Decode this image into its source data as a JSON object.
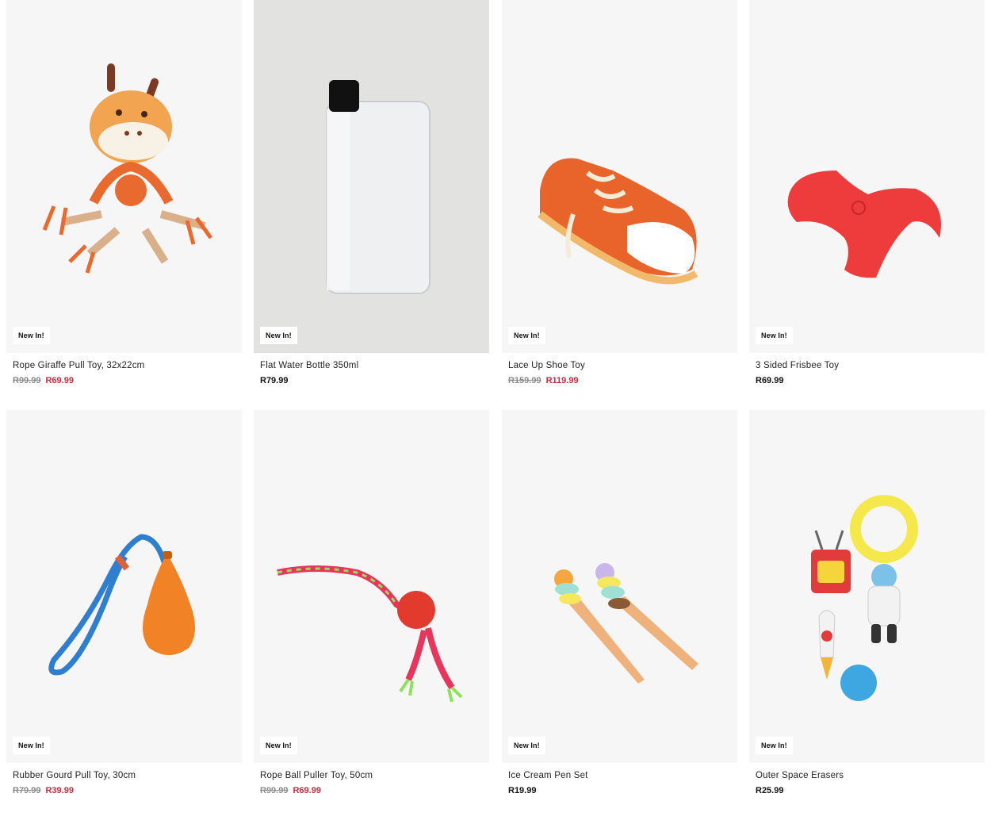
{
  "badge_label": "New In!",
  "products": [
    {
      "title": "Rope Giraffe Pull Toy, 32x22cm",
      "was_price": "R99.99",
      "price": "R69.99",
      "image": "giraffe-rope-toy"
    },
    {
      "title": "Flat Water Bottle 350ml",
      "was_price": "",
      "price": "R79.99",
      "image": "flat-water-bottle"
    },
    {
      "title": "Lace Up Shoe Toy",
      "was_price": "R159.99",
      "price": "R119.99",
      "image": "shoe-toy"
    },
    {
      "title": "3 Sided Frisbee Toy",
      "was_price": "",
      "price": "R69.99",
      "image": "frisbee-toy"
    },
    {
      "title": "Rubber Gourd Pull Toy, 30cm",
      "was_price": "R79.99",
      "price": "R39.99",
      "image": "gourd-pull-toy"
    },
    {
      "title": "Rope Ball Puller Toy, 50cm",
      "was_price": "R99.99",
      "price": "R69.99",
      "image": "rope-ball-toy"
    },
    {
      "title": "Ice Cream Pen Set",
      "was_price": "",
      "price": "R19.99",
      "image": "ice-cream-pens"
    },
    {
      "title": "Outer Space Erasers",
      "was_price": "",
      "price": "R25.99",
      "image": "space-erasers"
    }
  ],
  "colors": {
    "sale": "#c62d3c",
    "was": "#8a8a8a",
    "card_bg": "#f6f6f6"
  }
}
